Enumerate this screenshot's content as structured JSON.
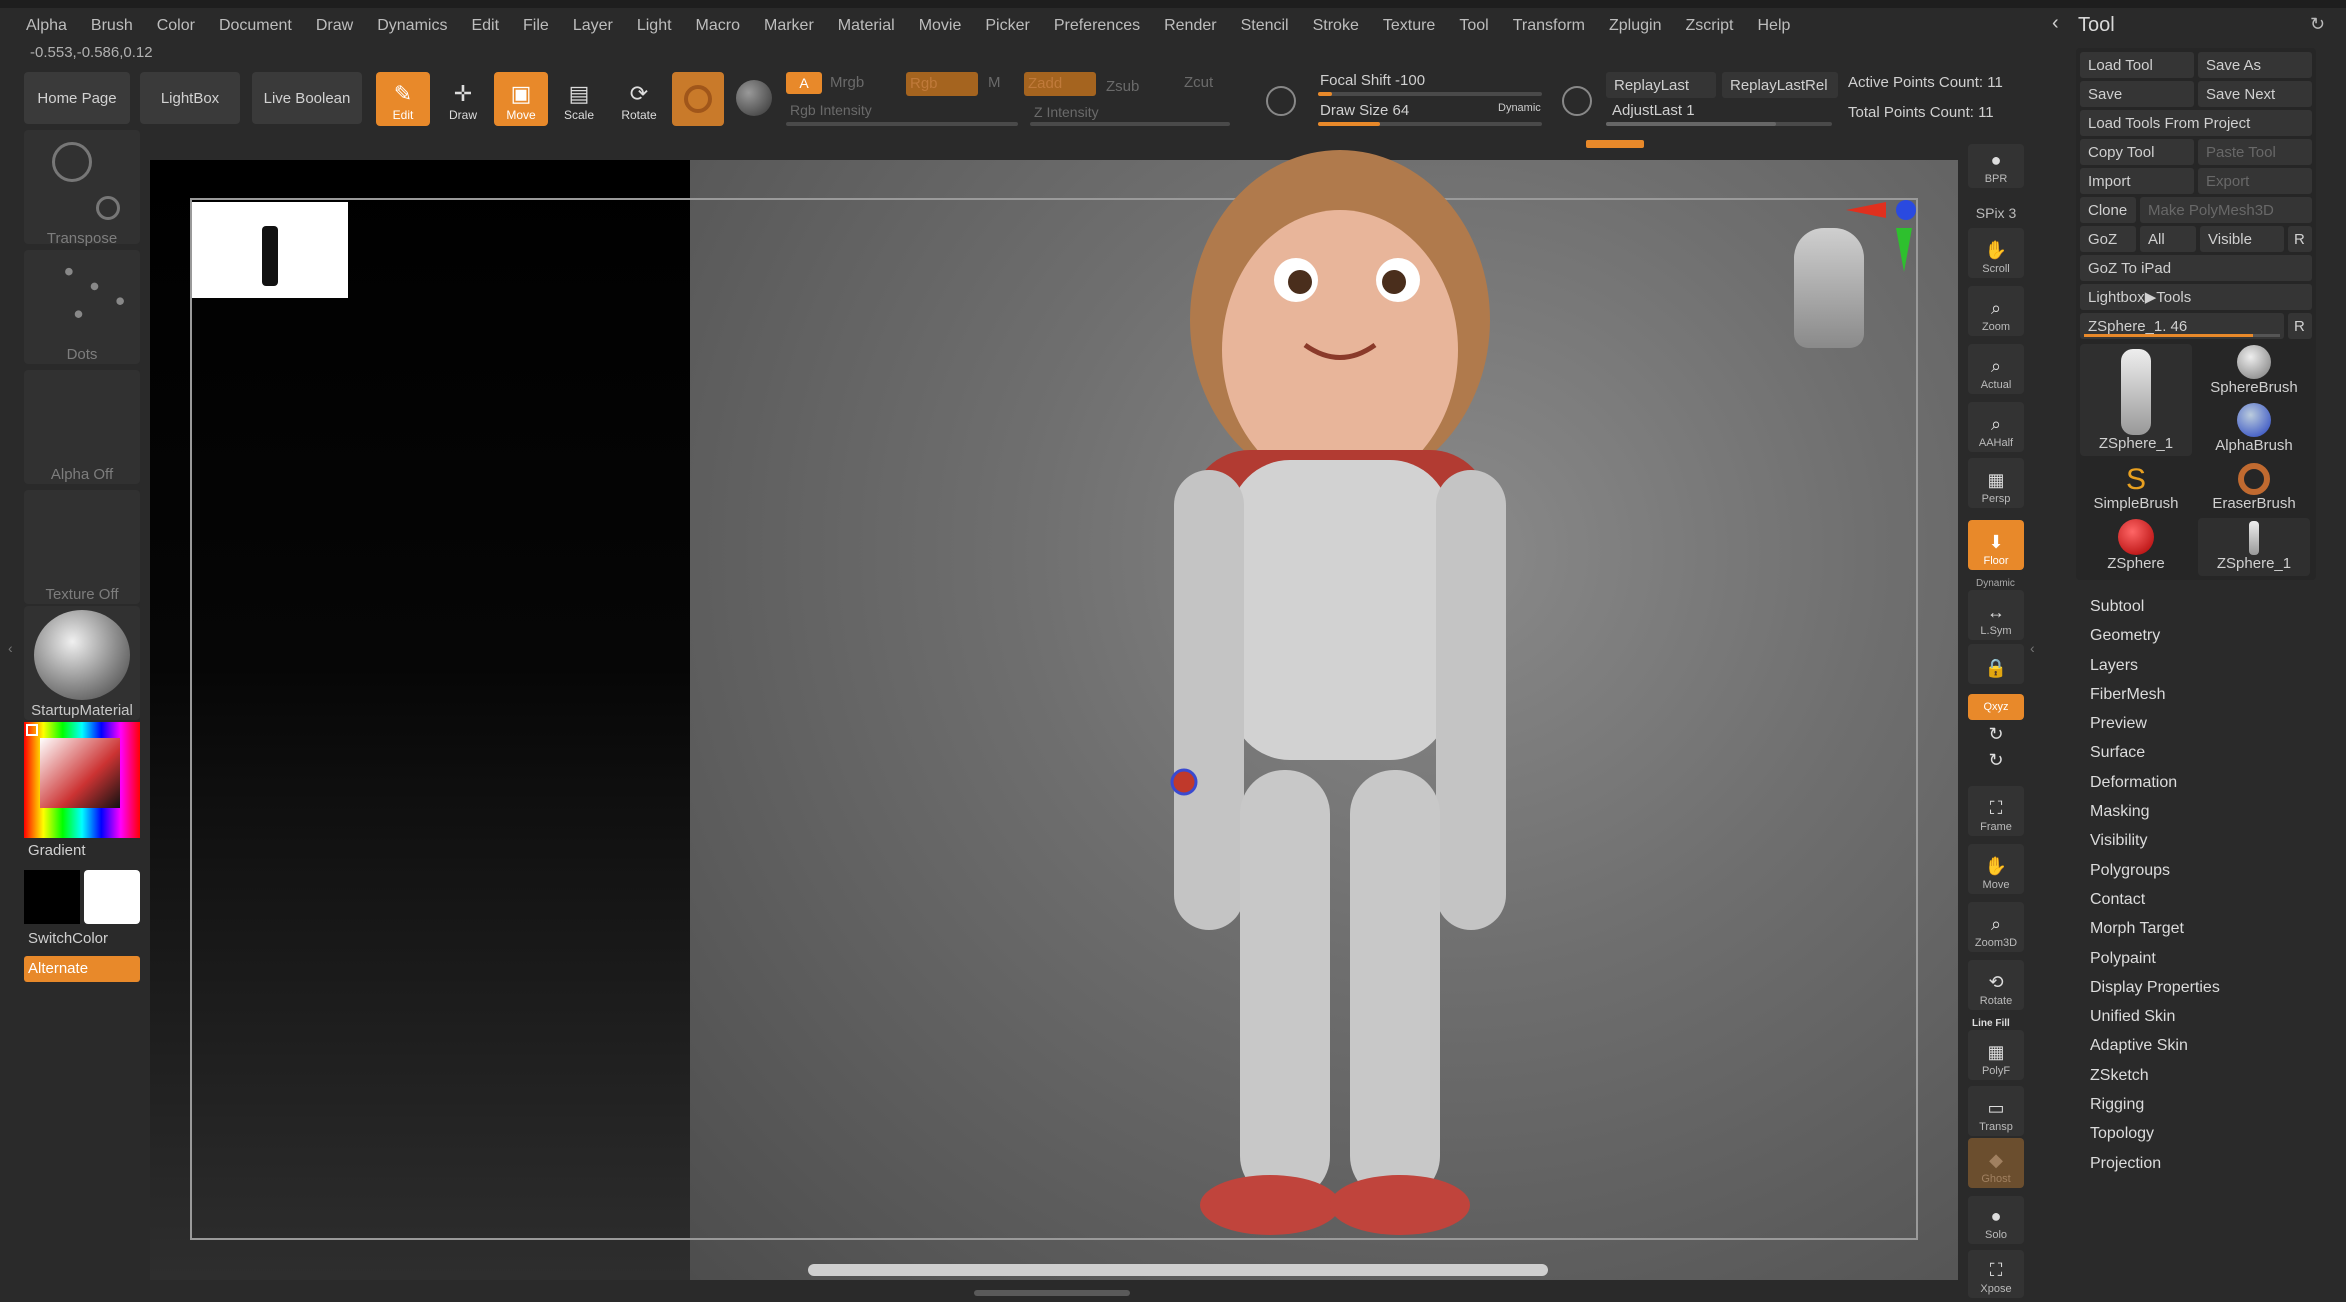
{
  "menu": [
    "Alpha",
    "Brush",
    "Color",
    "Document",
    "Draw",
    "Dynamics",
    "Edit",
    "File",
    "Layer",
    "Light",
    "Macro",
    "Marker",
    "Material",
    "Movie",
    "Picker",
    "Preferences",
    "Render",
    "Stencil",
    "Stroke",
    "Texture",
    "Tool",
    "Transform",
    "Zplugin",
    "Zscript",
    "Help"
  ],
  "coords": "-0.553,-0.586,0.12",
  "toolbar": {
    "home_page": "Home Page",
    "lightbox": "LightBox",
    "live_boolean": "Live Boolean",
    "edit": "Edit",
    "draw": "Draw",
    "move": "Move",
    "scale": "Scale",
    "rotate": "Rotate",
    "a": "A",
    "mrgb": "Mrgb",
    "rgb": "Rgb",
    "m": "M",
    "zadd": "Zadd",
    "zsub": "Zsub",
    "zcut": "Zcut",
    "rgb_intensity": "Rgb Intensity",
    "z_intensity": "Z Intensity",
    "focal_shift": "Focal Shift -100",
    "draw_size": "Draw Size 64",
    "dynamic": "Dynamic",
    "replay_last": "ReplayLast",
    "replay_last_rel": "ReplayLastRel",
    "adjust_last": "AdjustLast 1",
    "active_points": "Active Points Count: 11",
    "total_points": "Total Points Count: 11"
  },
  "left_shelf": {
    "transpose": "Transpose",
    "dots": "Dots",
    "alpha_off": "Alpha Off",
    "texture_off": "Texture Off",
    "material": "StartupMaterial",
    "gradient": "Gradient",
    "switch_color": "SwitchColor",
    "alternate": "Alternate"
  },
  "right_shelf": [
    "BPR",
    "SPix 3",
    "Scroll",
    "Zoom",
    "Actual",
    "AAHalf",
    "Persp",
    "Floor",
    "L.Sym",
    "Qxyz",
    "Frame",
    "Move",
    "Zoom3D",
    "Rotate",
    "PolyF",
    "Transp",
    "Ghost",
    "Solo",
    "Xpose"
  ],
  "right_shelf_extra": {
    "dynamic": "Dynamic",
    "line_fill": "Line Fill"
  },
  "tool_panel": {
    "title": "Tool",
    "load_tool": "Load Tool",
    "save_as": "Save As",
    "save": "Save",
    "save_next": "Save Next",
    "load_from_project": "Load Tools From Project",
    "copy_tool": "Copy Tool",
    "paste_tool": "Paste Tool",
    "import": "Import",
    "export": "Export",
    "clone": "Clone",
    "make_polymesh": "Make PolyMesh3D",
    "goz": "GoZ",
    "all": "All",
    "visible": "Visible",
    "r": "R",
    "goz_ipad": "GoZ To iPad",
    "lightbox_tools": "Lightbox▶Tools",
    "current_tool": "ZSphere_1. 46",
    "tools": [
      "ZSphere_1",
      "SphereBrush",
      "AlphaBrush",
      "SimpleBrush",
      "EraserBrush",
      "ZSphere",
      "ZSphere_1"
    ],
    "sections": [
      "Subtool",
      "Geometry",
      "Layers",
      "FiberMesh",
      "Preview",
      "Surface",
      "Deformation",
      "Masking",
      "Visibility",
      "Polygroups",
      "Contact",
      "Morph Target",
      "Polypaint",
      "Display Properties",
      "Unified Skin",
      "Adaptive Skin",
      "ZSketch",
      "Rigging",
      "Topology",
      "Projection"
    ]
  },
  "colors": {
    "accent": "#e8892a",
    "panel": "#353535",
    "bg": "#2a2a2a"
  }
}
